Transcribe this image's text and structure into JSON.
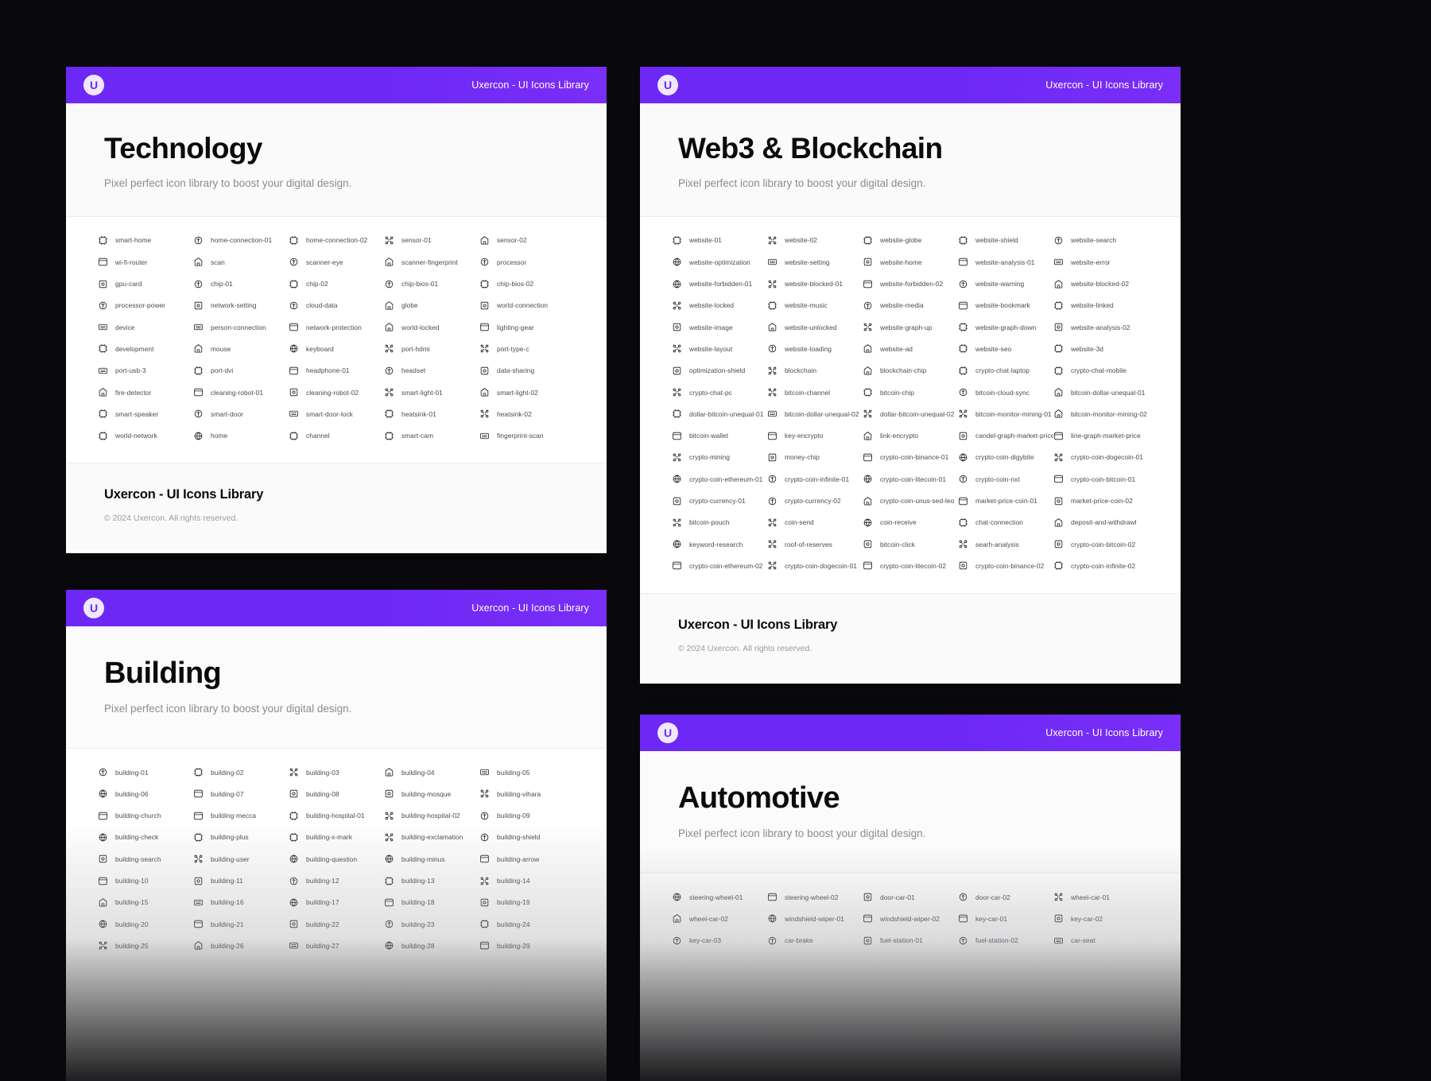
{
  "brand": {
    "logo_letter": "U",
    "bar_title": "Uxercon - UI Icons Library",
    "accent": "#6d28f5",
    "bg": "#0a0a0c"
  },
  "footer": {
    "title": "Uxercon - UI Icons Library",
    "copyright": "© 2024 Uxercon. All rights reserved."
  },
  "cards": {
    "technology": {
      "title": "Technology",
      "subtitle": "Pixel perfect icon library to boost your digital design.",
      "icons": [
        "smart-home",
        "home-connection-01",
        "home-connection-02",
        "sensor-01",
        "sensor-02",
        "wi-fi-router",
        "scan",
        "scanner-eye",
        "scanner-fingerprint",
        "processor",
        "gpu-card",
        "chip-01",
        "chip-02",
        "chip-bios-01",
        "chip-bios-02",
        "processor-power",
        "network-setting",
        "cloud-data",
        "globe",
        "world-connection",
        "device",
        "person-connection",
        "network-protection",
        "world-locked",
        "lighting-gear",
        "development",
        "mouse",
        "keyboard",
        "port-hdmi",
        "port-type-c",
        "port-usb-3",
        "port-dvi",
        "headphone-01",
        "headset",
        "data-sharing",
        "fire-detector",
        "cleaning-robot-01",
        "cleaning-robot-02",
        "smart-light-01",
        "smart-light-02",
        "smart-speaker",
        "smart-door",
        "smart-door-lock",
        "heatsink-01",
        "heatsink-02",
        "world-network",
        "home",
        "channel",
        "smart-cam",
        "fingerprint-scan"
      ]
    },
    "web3": {
      "title": "Web3 & Blockchain",
      "subtitle": "Pixel perfect icon library to boost your digital design.",
      "icons": [
        "website-01",
        "website-02",
        "website-globe",
        "website-shield",
        "website-search",
        "website-optimization",
        "website-setting",
        "website-home",
        "website-analysis-01",
        "website-error",
        "website-forbidden-01",
        "website-blocked-01",
        "website-forbidden-02",
        "website-warning",
        "website-blocked-02",
        "website-locked",
        "website-music",
        "website-media",
        "website-bookmark",
        "website-linked",
        "website-image",
        "website-unlocked",
        "website-graph-up",
        "website-graph-down",
        "website-analysis-02",
        "website-layout",
        "website-loading",
        "website-ad",
        "website-seo",
        "website-3d",
        "optimization-shield",
        "blockchain",
        "blockchain-chip",
        "crypto-chat-laptop",
        "crypto-chat-mobile",
        "crypto-chat-pc",
        "bitcoin-channel",
        "bitcoin-chip",
        "bitcoin-cloud-sync",
        "bitcoin-dollar-unequal-01",
        "dollar-bitcoin-unequal-01",
        "bitcoin-dollar-unequal-02",
        "dollar-bitcoin-unequal-02",
        "bitcoin-monitor-mining-01",
        "bitcoin-monitor-mining-02",
        "bitcoin-wallet",
        "key-encrypto",
        "link-encrypto",
        "candel-graph-market-price",
        "line-graph-market-price",
        "crypto-mining",
        "money-chip",
        "crypto-coin-binance-01",
        "crypto-coin-digybite",
        "crypto-coin-dogecoin-01",
        "crypto-coin-ethereum-01",
        "crypto-coin-infinite-01",
        "crypto-coin-litecoin-01",
        "crypto-coin-nxt",
        "crypto-coin-bitcoin-01",
        "crypto-currency-01",
        "crypto-currency-02",
        "crypto-coin-unus-sed-leo",
        "market-price-coin-01",
        "market-price-coin-02",
        "bitcoin-pouch",
        "coin-send",
        "coin-receive",
        "chat-connection",
        "deposit-and-withdrawl",
        "keyword-research",
        "roof-of-reserves",
        "bitcoin-click",
        "searh-analysis",
        "crypto-coin-bitcoin-02",
        "crypto-coin-ethereum-02",
        "crypto-coin-dogecoin-01",
        "crypto-coin-litecoin-02",
        "crypto-coin-binance-02",
        "crypto-coin-infinite-02"
      ]
    },
    "building": {
      "title": "Building",
      "subtitle": "Pixel perfect icon library to boost your digital design.",
      "icons": [
        "building-01",
        "building-02",
        "building-03",
        "building-04",
        "building-05",
        "building-06",
        "building-07",
        "building-08",
        "building-mosque",
        "building-vihara",
        "building-church",
        "building-mecca",
        "building-hospital-01",
        "building-hospital-02",
        "building-09",
        "building-check",
        "building-plus",
        "building-x-mark",
        "building-exclamation",
        "building-shield",
        "building-search",
        "building-user",
        "building-question",
        "building-minus",
        "building-arrow",
        "building-10",
        "building-11",
        "building-12",
        "building-13",
        "building-14",
        "building-15",
        "building-16",
        "building-17",
        "building-18",
        "building-19",
        "building-20",
        "building-21",
        "building-22",
        "building-23",
        "building-24",
        "building-25",
        "building-26",
        "building-27",
        "building-28",
        "building-29"
      ]
    },
    "automotive": {
      "title": "Automotive",
      "subtitle": "Pixel perfect icon library to boost your digital design.",
      "icons": [
        "steering-wheel-01",
        "steering-wheel-02",
        "door-car-01",
        "door-car-02",
        "wheel-car-01",
        "wheel-car-02",
        "windshield-wiper-01",
        "windshield-wiper-02",
        "key-car-01",
        "key-car-02",
        "key-car-03",
        "car-brake",
        "fuel-station-01",
        "fuel-station-02",
        "car-seat"
      ]
    }
  }
}
